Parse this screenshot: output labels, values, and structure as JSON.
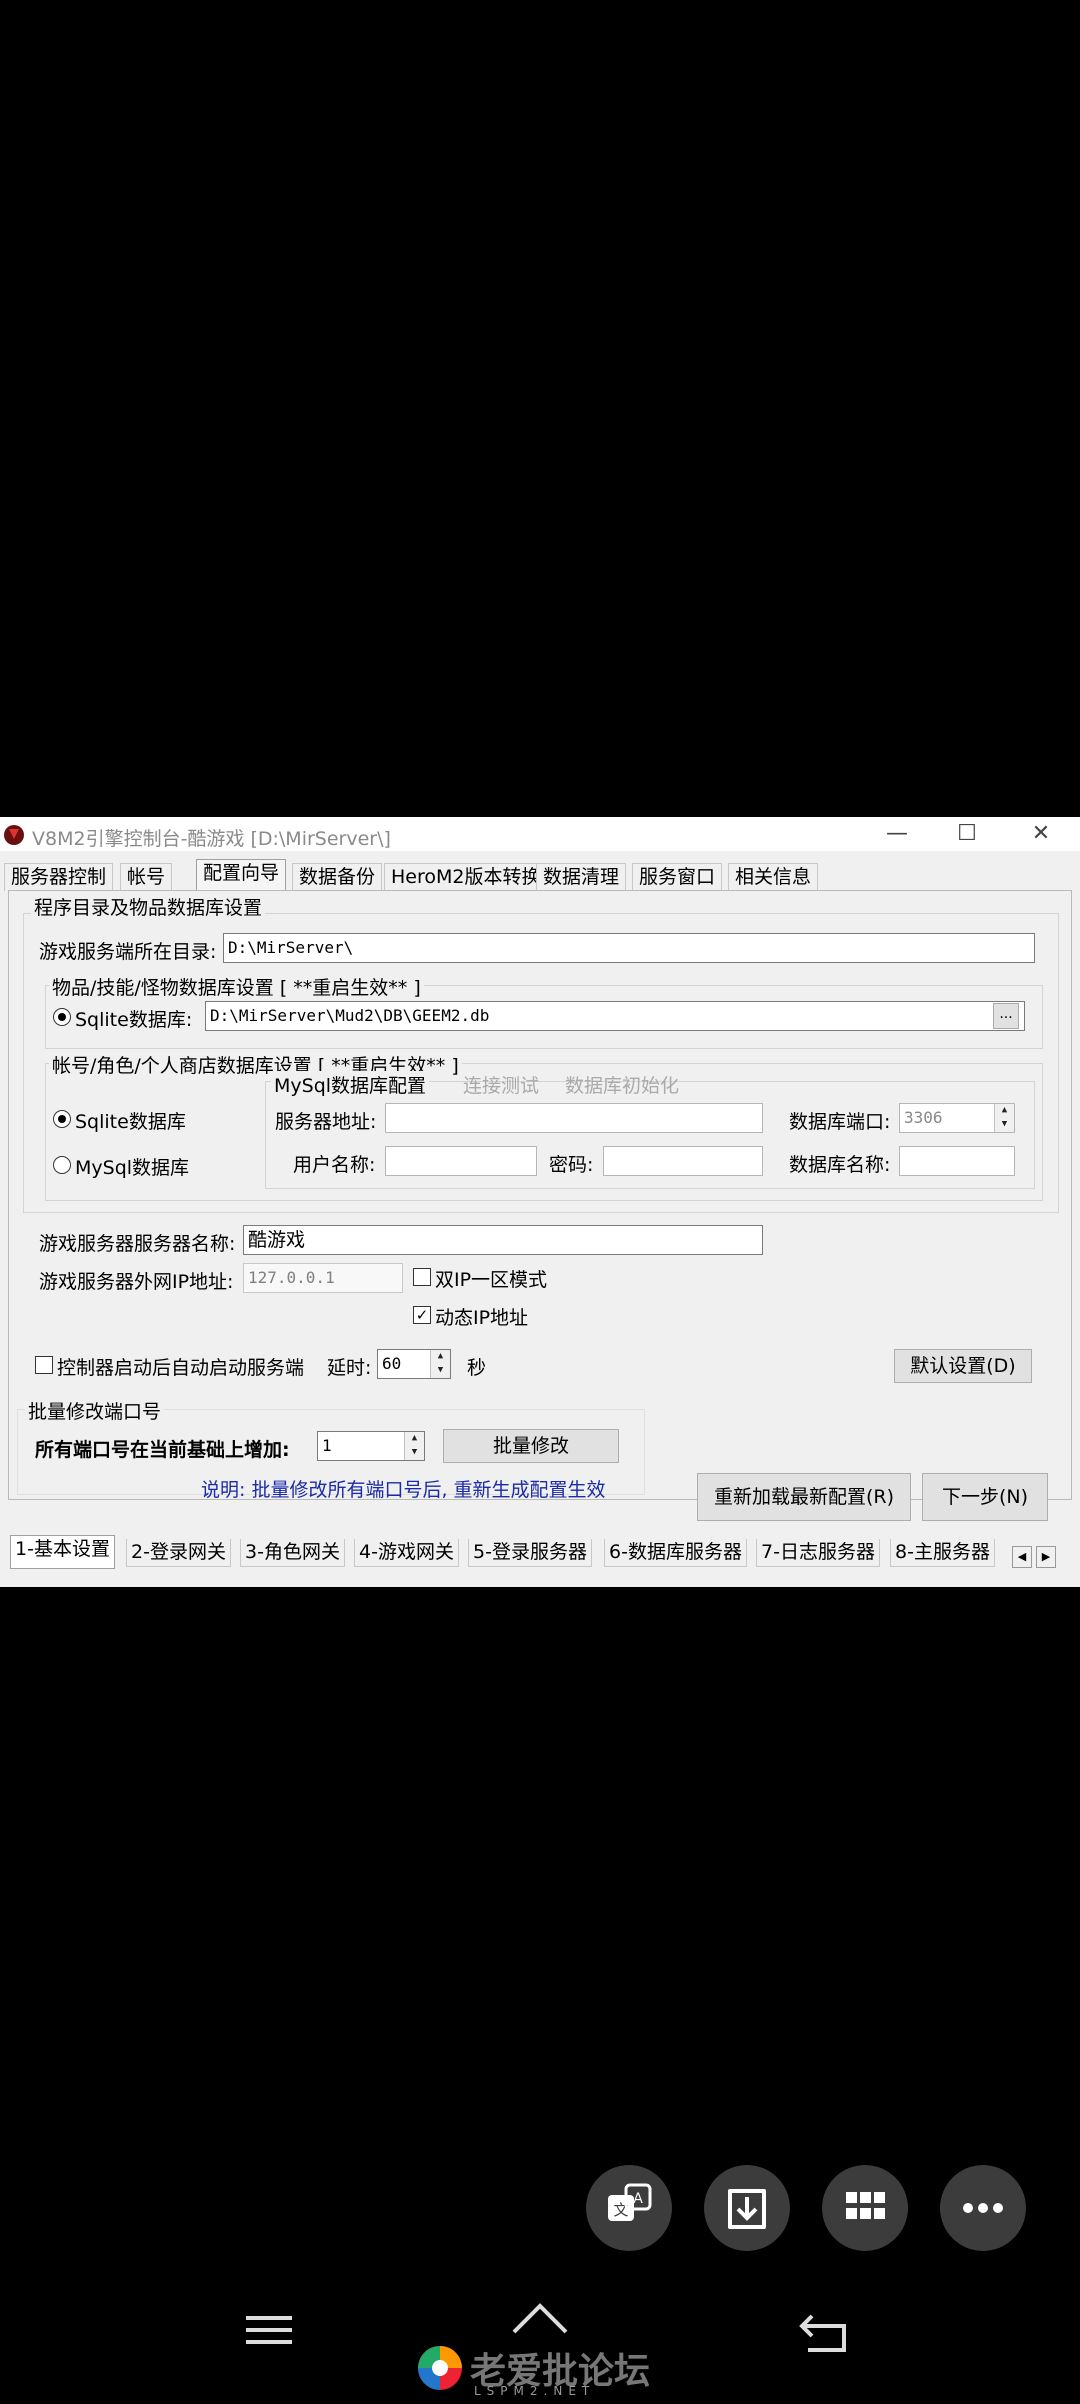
{
  "window": {
    "title": "V8M2引擎控制台-酷游戏 [D:\\MirServer\\]"
  },
  "top_tabs": [
    "服务器控制",
    "帐号",
    "配置向导",
    "数据备份",
    "HeroM2版本转换",
    "数据清理",
    "服务窗口",
    "相关信息"
  ],
  "active_top_tab": "配置向导",
  "group_program": {
    "title": "程序目录及物品数据库设置",
    "server_dir_label": "游戏服务端所在目录:",
    "server_dir_value": "D:\\MirServer\\",
    "item_db_group_title": "物品/技能/怪物数据库设置 [ **重启生效** ]",
    "sqlite_label": "Sqlite数据库:",
    "sqlite_path": "D:\\MirServer\\Mud2\\DB\\GEEM2.db",
    "browse_label": "..."
  },
  "group_account": {
    "title": "帐号/角色/个人商店数据库设置 [ **重启生效** ]",
    "sqlite_label": "Sqlite数据库",
    "mysql_label": "MySql数据库",
    "mysql_config_title": "MySql数据库配置",
    "test_link": "连接测试",
    "init_link": "数据库初始化",
    "server_addr_label": "服务器地址:",
    "db_port_label": "数据库端口:",
    "db_port_value": "3306",
    "username_label": "用户名称:",
    "password_label": "密码:",
    "db_name_label": "数据库名称:"
  },
  "server": {
    "name_label": "游戏服务器服务器名称:",
    "name_value": "酷游戏",
    "ip_label": "游戏服务器外网IP地址:",
    "ip_value": "127.0.0.1",
    "dual_ip_label": "双IP一区模式",
    "dynamic_ip_label": "动态IP地址",
    "autostart_label": "控制器启动后自动启动服务端",
    "delay_label": "延时:",
    "delay_value": "60",
    "seconds_label": "秒",
    "default_btn": "默认设置(D)"
  },
  "batch": {
    "title": "批量修改端口号",
    "increase_label": "所有端口号在当前基础上增加:",
    "increase_value": "1",
    "batch_btn": "批量修改",
    "note": "说明: 批量修改所有端口号后, 重新生成配置生效"
  },
  "actions": {
    "reload_btn": "重新加载最新配置(R)",
    "next_btn": "下一步(N)"
  },
  "bottom_tabs": [
    "1-基本设置",
    "2-登录网关",
    "3-角色网关",
    "4-游戏网关",
    "5-登录服务器",
    "6-数据库服务器",
    "7-日志服务器",
    "8-主服务器"
  ],
  "active_bottom_tab": "1-基本设置",
  "colors": {
    "note_blue": "#1a2aa8",
    "fab_bg": "#3c3c3c",
    "black_bg": "#000000"
  },
  "overlay": {
    "fab_icons": [
      "translate-icon",
      "download-icon",
      "grid-icon",
      "more-icon"
    ],
    "nav_icons": [
      "menu-icon",
      "home-icon",
      "back-icon"
    ],
    "watermark": "老爱批论坛",
    "watermark_sub": "LSPM2.NET"
  }
}
